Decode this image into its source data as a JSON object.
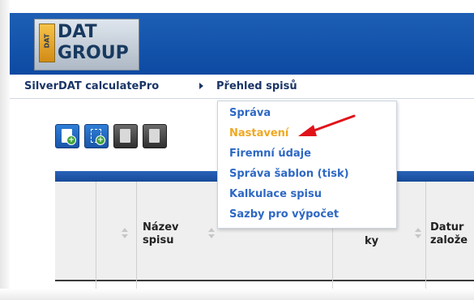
{
  "logo": {
    "badge_text": "DAT",
    "line1": "DAT",
    "line2": "GROUP"
  },
  "breadcrumb": {
    "root": "SilverDAT calculatePro",
    "current": "Přehled spisů"
  },
  "toolbar": {
    "buttons": [
      {
        "icon": "new-document-icon"
      },
      {
        "icon": "import-document-icon"
      },
      {
        "icon": "copy-document-icon"
      },
      {
        "icon": "document-icon"
      }
    ]
  },
  "menu": {
    "items": [
      {
        "label": "Správa",
        "active": false
      },
      {
        "label": "Nastavení",
        "active": true
      },
      {
        "label": "Firemní údaje",
        "active": false
      },
      {
        "label": "Správa šablon (tisk)",
        "active": false
      },
      {
        "label": "Kalkulace spisu",
        "active": false
      },
      {
        "label": "Sazby pro výpočet",
        "active": false
      }
    ]
  },
  "table": {
    "headers": {
      "name_line1": "Název",
      "name_line2": "spisu",
      "col_partial": "ky",
      "date_line1": "Datur",
      "date_line2": "založe"
    }
  },
  "colors": {
    "header_blue": "#0d4aa3",
    "menu_link": "#2d68c4",
    "menu_active": "#f0a821",
    "arrow_red": "#e0131b"
  }
}
